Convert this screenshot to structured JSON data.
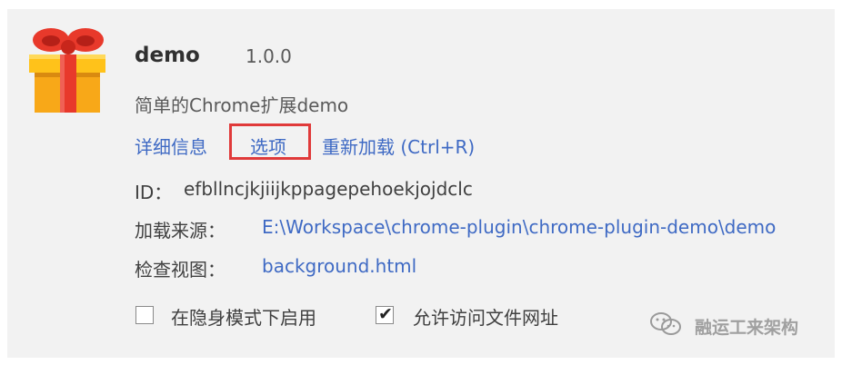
{
  "extension": {
    "name": "demo",
    "version": "1.0.0",
    "description": "简单的Chrome扩展demo",
    "icon": "gift-box-icon"
  },
  "links": {
    "details": "详细信息",
    "options": "选项",
    "reload": "重新加载 (Ctrl+R)"
  },
  "id_row": {
    "label": "ID：",
    "value": "efbllncjkjiijkppagepehoekjojdclc"
  },
  "source_row": {
    "label": "加载来源：",
    "value": "E:\\Workspace\\chrome-plugin\\chrome-plugin-demo\\demo"
  },
  "inspect_row": {
    "label": "检查视图：",
    "value": "background.html"
  },
  "checkboxes": [
    {
      "label": "在隐身模式下启用",
      "checked": false
    },
    {
      "label": "允许访问文件网址",
      "checked": true
    }
  ],
  "watermark": {
    "text": "融运工来架构",
    "icon": "wechat-logo-icon"
  },
  "colors": {
    "link": "#3f6ac4",
    "highlight_box": "#e03a3a",
    "card_bg": "#f2f2f2"
  }
}
